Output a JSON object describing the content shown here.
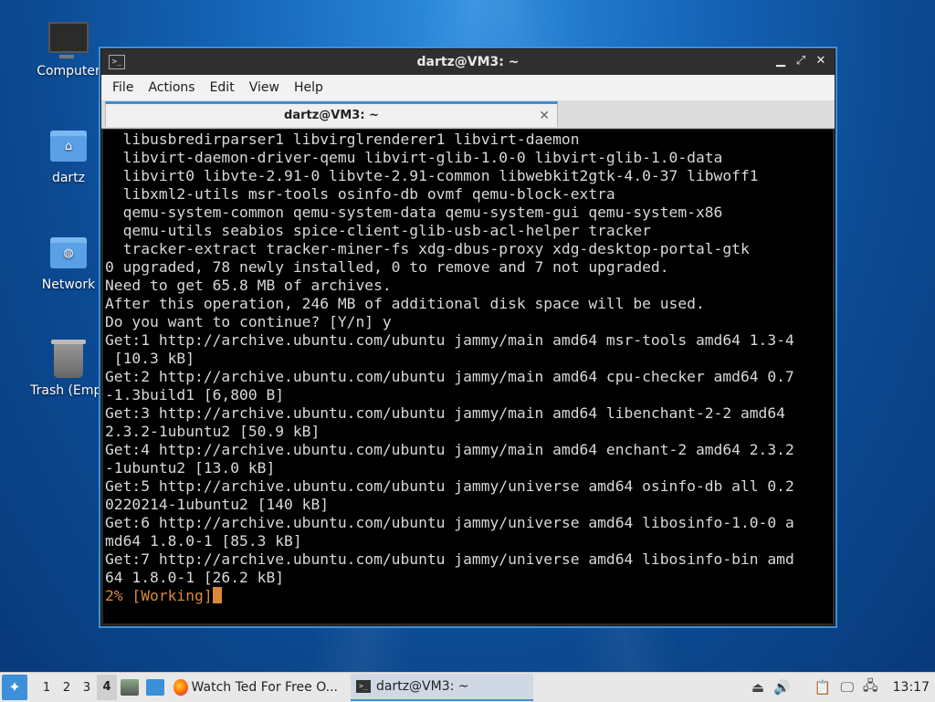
{
  "desktop": {
    "icons": [
      {
        "label": "Computer",
        "icon": "computer-icon"
      },
      {
        "label": "dartz",
        "icon": "home-folder-icon"
      },
      {
        "label": "Network",
        "icon": "network-folder-icon"
      },
      {
        "label": "Trash (Empt",
        "icon": "trash-icon"
      }
    ]
  },
  "window": {
    "title": "dartz@VM3: ~",
    "controls": {
      "minimize": "▁",
      "maximize": "⤢",
      "close": "✕"
    },
    "menu": [
      "File",
      "Actions",
      "Edit",
      "View",
      "Help"
    ],
    "tab": {
      "label": "dartz@VM3: ~",
      "close": "✕"
    },
    "terminal_lines": [
      "  libusbredirparser1 libvirglrenderer1 libvirt-daemon",
      "  libvirt-daemon-driver-qemu libvirt-glib-1.0-0 libvirt-glib-1.0-data",
      "  libvirt0 libvte-2.91-0 libvte-2.91-common libwebkit2gtk-4.0-37 libwoff1",
      "  libxml2-utils msr-tools osinfo-db ovmf qemu-block-extra",
      "  qemu-system-common qemu-system-data qemu-system-gui qemu-system-x86",
      "  qemu-utils seabios spice-client-glib-usb-acl-helper tracker",
      "  tracker-extract tracker-miner-fs xdg-dbus-proxy xdg-desktop-portal-gtk",
      "0 upgraded, 78 newly installed, 0 to remove and 7 not upgraded.",
      "Need to get 65.8 MB of archives.",
      "After this operation, 246 MB of additional disk space will be used.",
      "Do you want to continue? [Y/n] y",
      "Get:1 http://archive.ubuntu.com/ubuntu jammy/main amd64 msr-tools amd64 1.3-4",
      " [10.3 kB]",
      "Get:2 http://archive.ubuntu.com/ubuntu jammy/main amd64 cpu-checker amd64 0.7",
      "-1.3build1 [6,800 B]",
      "Get:3 http://archive.ubuntu.com/ubuntu jammy/main amd64 libenchant-2-2 amd64",
      "2.3.2-1ubuntu2 [50.9 kB]",
      "Get:4 http://archive.ubuntu.com/ubuntu jammy/main amd64 enchant-2 amd64 2.3.2",
      "-1ubuntu2 [13.0 kB]",
      "Get:5 http://archive.ubuntu.com/ubuntu jammy/universe amd64 osinfo-db all 0.2",
      "0220214-1ubuntu2 [140 kB]",
      "Get:6 http://archive.ubuntu.com/ubuntu jammy/universe amd64 libosinfo-1.0-0 a",
      "md64 1.8.0-1 [85.3 kB]",
      "Get:7 http://archive.ubuntu.com/ubuntu jammy/universe amd64 libosinfo-bin amd",
      "64 1.8.0-1 [26.2 kB]"
    ],
    "progress_line": "2% [Working]",
    "colors": {
      "accent": "#3c8fd8",
      "progress": "#d9893a",
      "terminal_bg": "#000000"
    }
  },
  "taskbar": {
    "workspaces": [
      "1",
      "2",
      "3",
      "4"
    ],
    "active_workspace": "4",
    "tasks": [
      {
        "label": "Watch Ted For Free O...",
        "icon": "firefox-icon"
      },
      {
        "label": "dartz@VM3: ~",
        "icon": "terminal-icon"
      }
    ],
    "clock": "13:17"
  }
}
